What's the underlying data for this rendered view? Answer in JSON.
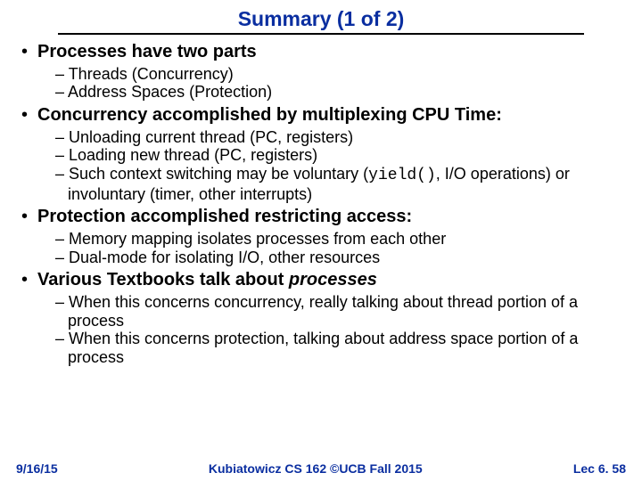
{
  "title": "Summary (1 of 2)",
  "bullets": [
    {
      "text": "Processes have two parts",
      "sub": [
        "Threads (Concurrency)",
        "Address Spaces (Protection)"
      ]
    },
    {
      "text": "Concurrency accomplished by multiplexing CPU Time:",
      "sub": [
        "Unloading current thread (PC, registers)",
        "Loading new thread (PC, registers)",
        {
          "pre": "Such context switching may be voluntary (",
          "code": "yield()",
          "post": ", I/O operations) or involuntary (timer, other interrupts)"
        }
      ]
    },
    {
      "text": "Protection accomplished restricting access:",
      "sub": [
        "Memory mapping isolates processes from each other",
        "Dual-mode for isolating I/O, other resources"
      ]
    },
    {
      "pre": "Various Textbooks talk about ",
      "ital": "processes",
      "sub": [
        "When this concerns concurrency, really talking about thread portion of a process",
        "When this concerns protection, talking about address space portion of a process"
      ]
    }
  ],
  "footer": {
    "left": "9/16/15",
    "center": "Kubiatowicz CS 162 ©UCB Fall 2015",
    "right": "Lec 6. 58"
  }
}
